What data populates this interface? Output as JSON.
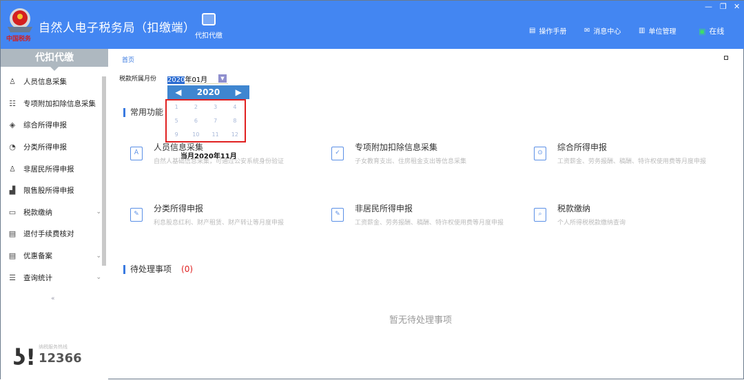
{
  "header": {
    "title": "自然人电子税务局（扣缴端）",
    "logo_text": "中国税务",
    "top_nav": {
      "label": "代扣代缴",
      "icon": "wallet-icon"
    },
    "right_nav": [
      {
        "label": "操作手册",
        "icon": "document-icon"
      },
      {
        "label": "消息中心",
        "icon": "mail-icon"
      },
      {
        "label": "单位管理",
        "icon": "building-icon"
      },
      {
        "label": "在线",
        "icon": "monitor-check-icon"
      }
    ],
    "window_controls": {
      "minimize": "—",
      "restore": "❐",
      "close": "✕"
    }
  },
  "sidebar": {
    "title": "代扣代缴",
    "items": [
      {
        "label": "人员信息采集",
        "icon": "person-icon"
      },
      {
        "label": "专项附加扣除信息采集",
        "icon": "list-icon"
      },
      {
        "label": "综合所得申报",
        "icon": "layers-icon"
      },
      {
        "label": "分类所得申报",
        "icon": "pie-icon"
      },
      {
        "label": "非居民所得申报",
        "icon": "user-icon"
      },
      {
        "label": "限售股所得申报",
        "icon": "bar-chart-icon"
      },
      {
        "label": "税款缴纳",
        "icon": "folder-icon",
        "expandable": true
      },
      {
        "label": "退付手续费核对",
        "icon": "doc-icon"
      },
      {
        "label": "优惠备案",
        "icon": "doc-icon",
        "expandable": true
      },
      {
        "label": "查询统计",
        "icon": "search-list-icon",
        "expandable": true
      }
    ],
    "hotline_label": "纳税服务热线",
    "hotline": "12366"
  },
  "main": {
    "breadcrumb": "首页",
    "period": {
      "label": "税款所属月份",
      "year_selected": "2020",
      "value_rest": "年01月",
      "picker_year": "2020",
      "months": [
        "1",
        "2",
        "3",
        "4",
        "5",
        "6",
        "7",
        "8",
        "9",
        "10",
        "11",
        "12"
      ],
      "current_month_text": "当月2020年11月"
    },
    "common_title": "常用功能",
    "cards": [
      {
        "title": "人员信息采集",
        "desc": "自然人基础信息采集，可通过公安系统身份验证"
      },
      {
        "title": "专项附加扣除信息采集",
        "desc": "子女教育支出、住房租金支出等信息采集"
      },
      {
        "title": "综合所得申报",
        "desc": "工资薪金、劳务报酬、稿酬、特许权使用费等月度申报"
      },
      {
        "title": "分类所得申报",
        "desc": "利息股息红利、财产租赁、财产转让等月度申报"
      },
      {
        "title": "非居民所得申报",
        "desc": "工资薪金、劳务报酬、稿酬、特许权使用费等月度申报"
      },
      {
        "title": "税款缴纳",
        "desc": "个人所得税税款缴纳查询"
      }
    ],
    "pending_title": "待处理事项",
    "pending_count": "(0)",
    "empty_text": "暂无待处理事项"
  },
  "colors": {
    "header": "#4386f2",
    "accent": "#3a7ae0",
    "highlight_border": "#e02020",
    "pending_count": "#e02020"
  }
}
